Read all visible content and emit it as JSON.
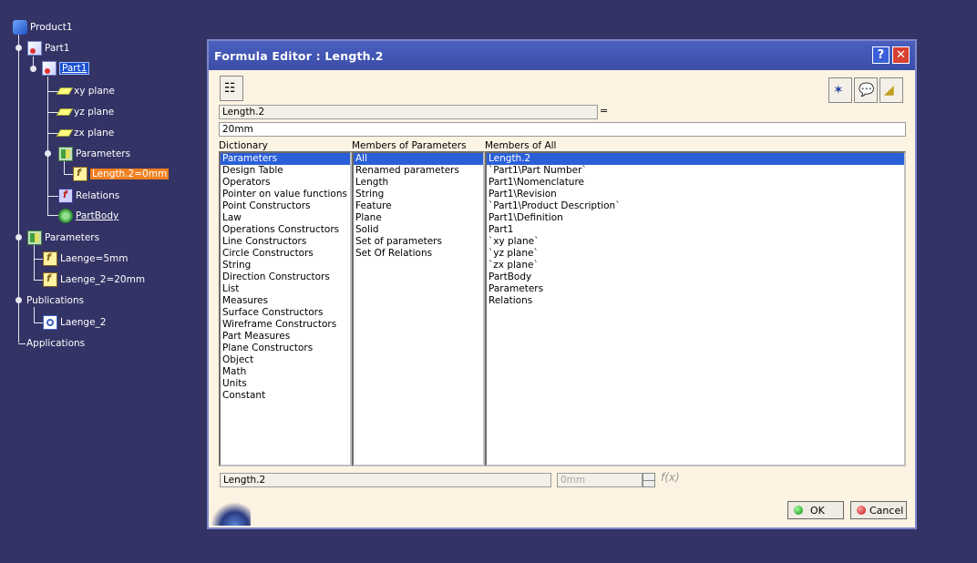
{
  "tree": {
    "nodes": [
      {
        "label": "Product1",
        "icon": "product-icon"
      },
      {
        "label": "Part1",
        "icon": "part-icon"
      },
      {
        "label": "Part1",
        "icon": "part-icon"
      },
      {
        "label": "xy plane",
        "icon": "plane-icon"
      },
      {
        "label": "yz plane",
        "icon": "plane-icon"
      },
      {
        "label": "zx plane",
        "icon": "plane-icon"
      },
      {
        "label": "Parameters",
        "icon": "parameters-icon"
      },
      {
        "label": "Length.2=0mm",
        "icon": "formula-icon"
      },
      {
        "label": "Relations",
        "icon": "relations-icon"
      },
      {
        "label": "PartBody",
        "icon": "partbody-icon"
      },
      {
        "label": "Parameters",
        "icon": "parameters-icon"
      },
      {
        "label": "Laenge=5mm",
        "icon": "formula-icon"
      },
      {
        "label": "Laenge_2=20mm",
        "icon": "formula-icon"
      },
      {
        "label": "Publications",
        "icon": "none"
      },
      {
        "label": "Laenge_2",
        "icon": "publication-icon"
      },
      {
        "label": "Applications",
        "icon": "none"
      }
    ],
    "selected_color": "#f08020"
  },
  "dialog": {
    "title": "Formula Editor : Length.2",
    "help_glyph": "?",
    "close_glyph": "✕",
    "parameter_name": "Length.2",
    "equals": "=",
    "formula_value": "20mm",
    "dictionary": {
      "label": "Dictionary",
      "items": [
        "Parameters",
        "Design Table",
        "Operators",
        "Pointer on value functions",
        "Point Constructors",
        "Law",
        "Operations Constructors",
        "Line Constructors",
        "Circle Constructors",
        "String",
        "Direction Constructors",
        "List",
        "Measures",
        "Surface Constructors",
        "Wireframe Constructors",
        "Part Measures",
        "Plane Constructors",
        "Object",
        "Math",
        "Units",
        "Constant"
      ],
      "selected": 0
    },
    "members_of_parameters": {
      "label": "Members of Parameters",
      "items": [
        "All",
        "Renamed parameters",
        "Length",
        "String",
        "Feature",
        "Plane",
        "Solid",
        "Set of parameters",
        "Set Of Relations"
      ],
      "selected": 0
    },
    "members_of_all": {
      "label": "Members of All",
      "items": [
        "Length.2",
        "`Part1\\Part Number`",
        "Part1\\Nomenclature",
        "Part1\\Revision",
        "`Part1\\Product Description`",
        "Part1\\Definition",
        "Part1",
        "`xy plane`",
        "`yz plane`",
        "`zx plane`",
        "PartBody",
        "Parameters",
        "Relations"
      ],
      "selected": 0
    },
    "bottom_field": "Length.2",
    "value_field": "0mm",
    "fx_label": "f(x)",
    "ok_label": "OK",
    "cancel_label": "Cancel",
    "accent_color": "#2a5fd8"
  }
}
